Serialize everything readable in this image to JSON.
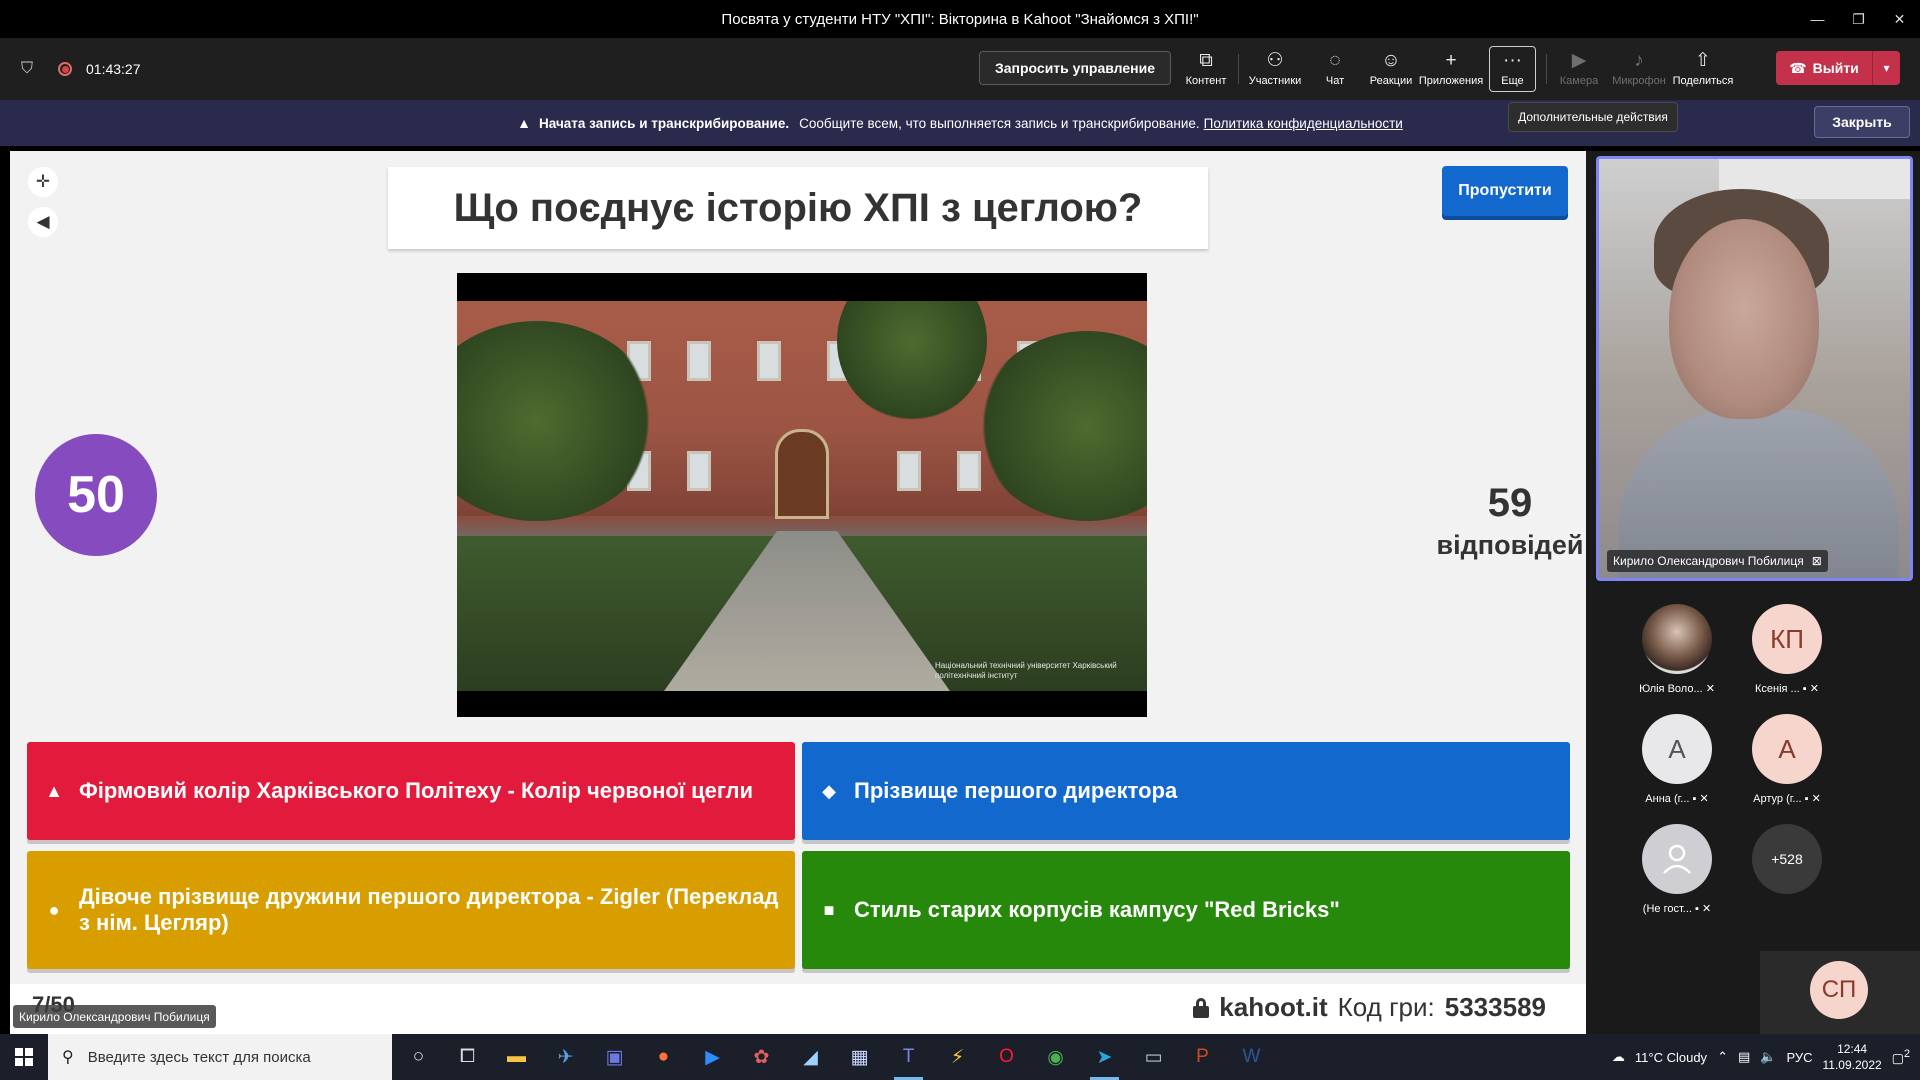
{
  "window": {
    "title": "Посвята у студенти НТУ \"ХПІ\": Вікторина в Kahoot \"Знайомся з ХПІ!\"",
    "controls": [
      "—",
      "❐",
      "✕"
    ]
  },
  "toolbar": {
    "timer": "01:43:27",
    "request_control": "Запросить управление",
    "items": [
      {
        "label": "Контент",
        "icon": "share-content-icon"
      },
      {
        "label": "Участники",
        "icon": "participants-icon"
      },
      {
        "label": "Чат",
        "icon": "chat-icon"
      },
      {
        "label": "Реакции",
        "icon": "reactions-icon"
      },
      {
        "label": "Приложения",
        "icon": "apps-icon"
      },
      {
        "label": "Еще",
        "icon": "more-icon"
      },
      {
        "label": "Камера",
        "icon": "camera-off-icon"
      },
      {
        "label": "Микрофон",
        "icon": "mic-off-icon"
      },
      {
        "label": "Поделиться",
        "icon": "share-icon"
      }
    ],
    "leave": "Выйти",
    "tooltip": "Дополнительные действия"
  },
  "banner": {
    "bold": "Начата запись и транскрибирование.",
    "text": "Сообщите всем, что выполняется запись и транскрибирование.",
    "link": "Политика конфиденциальности",
    "close": "Закрыть"
  },
  "kahoot": {
    "question": "Що поєднує історію ХПІ з цеглою?",
    "skip": "Пропустити",
    "timer": "50",
    "answers_count": "59",
    "answers_label": "відповідей",
    "answers": [
      {
        "shape": "▲",
        "text": "Фірмовий колір Харківського Політеху - Колір червоної цегли",
        "color": "#e21b3c"
      },
      {
        "shape": "◆",
        "text": "Прізвище першого директора",
        "color": "#1368ce"
      },
      {
        "shape": "●",
        "text": "Дівоче прізвище дружини першого директора - Zigler (Переклад з нім. Цегляр)",
        "color": "#d89e00"
      },
      {
        "shape": "■",
        "text": "Стиль старих корпусів кампусу \"Red Bricks\"",
        "color": "#26890c"
      }
    ],
    "progress": "7/50",
    "site": "kahoot.it",
    "code_label": "Код гри:",
    "code": "5333589",
    "watermark": "Національний технічний університет Харківський політехнічний інститут"
  },
  "presenter": "Кирило Олександрович Побилиця",
  "participants": [
    {
      "name": "Юлія Воло...",
      "initials": "",
      "kind": "photo"
    },
    {
      "name": "Ксенія ...",
      "initials": "КП",
      "kind": "initials"
    },
    {
      "name": "Анна (г...",
      "initials": "А",
      "kind": "initials-light"
    },
    {
      "name": "Артур (г...",
      "initials": "А",
      "kind": "initials"
    },
    {
      "name": "(Не гост...",
      "initials": "",
      "kind": "guest"
    },
    {
      "name": "",
      "initials": "+528",
      "kind": "more"
    }
  ],
  "self_tile": "СП",
  "taskbar": {
    "search_placeholder": "Введите здесь текст для поиска",
    "weather": "11°C  Cloudy",
    "lang": "РУС",
    "time": "12:44",
    "date": "11.09.2022",
    "notif_count": "2"
  },
  "colors": {
    "kahoot_purple": "#864cbf",
    "teams_purple_border": "#7f85f5",
    "leave_red": "#c4314b",
    "banner_bg": "#292a4c"
  }
}
